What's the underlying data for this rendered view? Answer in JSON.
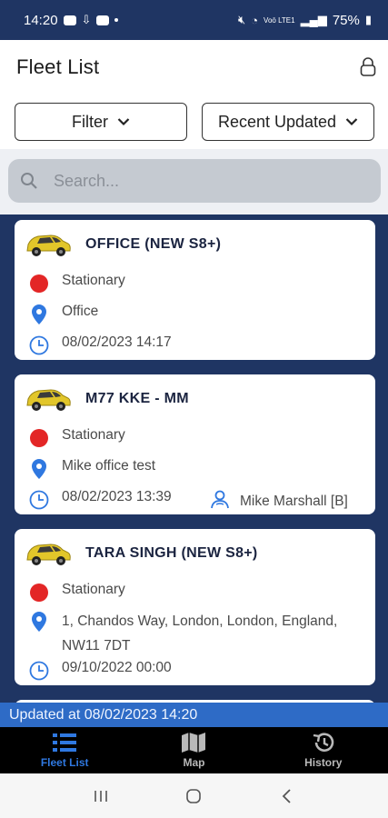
{
  "status_bar": {
    "time": "14:20",
    "battery": "75%",
    "network_label": "Voō LTE1"
  },
  "header": {
    "title": "Fleet List",
    "icon": "lock-icon"
  },
  "controls": {
    "filter_label": "Filter",
    "sort_label": "Recent Updated"
  },
  "search": {
    "placeholder": "Search..."
  },
  "vehicles": [
    {
      "name": "OFFICE (NEW S8+)",
      "status": "Stationary",
      "location": "Office",
      "timestamp": "08/02/2023 14:17",
      "driver": ""
    },
    {
      "name": "M77 KKE - MM",
      "status": "Stationary",
      "location": "Mike office test",
      "timestamp": "08/02/2023 13:39",
      "driver": "Mike Marshall [B]"
    },
    {
      "name": "TARA SINGH (NEW S8+)",
      "status": "Stationary",
      "location": "1, Chandos Way, London, London, England, NW11 7DT",
      "timestamp": "09/10/2022 00:00",
      "driver": ""
    }
  ],
  "updated_text": "Updated at 08/02/2023 14:20",
  "bottom_nav": {
    "items": [
      {
        "label": "Fleet List",
        "icon": "list-icon",
        "active": true
      },
      {
        "label": "Map",
        "icon": "map-icon",
        "active": false
      },
      {
        "label": "History",
        "icon": "history-icon",
        "active": false
      }
    ]
  },
  "colors": {
    "navy": "#1f3563",
    "accent_blue": "#2f78e0",
    "status_red": "#e32626",
    "updated_bar": "#2e6bc6"
  }
}
